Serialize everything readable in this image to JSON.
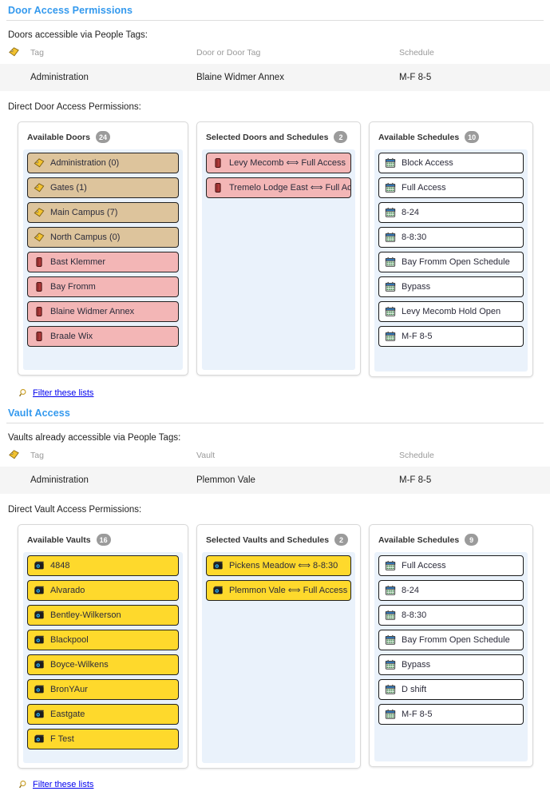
{
  "door_section": {
    "title": "Door Access Permissions",
    "tag_caption": "Doors accessible via People Tags:",
    "table": {
      "headers": [
        "Tag",
        "Door or Door Tag",
        "Schedule"
      ],
      "rows": [
        [
          "Administration",
          "Blaine Widmer Annex",
          "M-F 8-5"
        ]
      ]
    },
    "direct_caption": "Direct Door Access Permissions:",
    "available": {
      "label": "Available Doors",
      "count": "24",
      "items": [
        {
          "text": "Administration (0)",
          "kind": "tag"
        },
        {
          "text": "Gates (1)",
          "kind": "tag"
        },
        {
          "text": "Main Campus (7)",
          "kind": "tag"
        },
        {
          "text": "North Campus (0)",
          "kind": "tag"
        },
        {
          "text": "Bast Klemmer",
          "kind": "door"
        },
        {
          "text": "Bay Fromm",
          "kind": "door"
        },
        {
          "text": "Blaine Widmer Annex",
          "kind": "door"
        },
        {
          "text": "Braale Wix",
          "kind": "door"
        }
      ]
    },
    "selected": {
      "label": "Selected Doors and Schedules",
      "count": "2",
      "items": [
        {
          "text": "Levy Mecomb ⟺ Full Access",
          "kind": "door"
        },
        {
          "text": "Tremelo Lodge East ⟺ Full Access",
          "kind": "door"
        }
      ]
    },
    "schedules": {
      "label": "Available Schedules",
      "count": "10",
      "items": [
        {
          "text": "Block Access",
          "kind": "schedule"
        },
        {
          "text": "Full Access",
          "kind": "schedule"
        },
        {
          "text": "8-24",
          "kind": "schedule"
        },
        {
          "text": "8-8:30",
          "kind": "schedule"
        },
        {
          "text": "Bay Fromm Open Schedule",
          "kind": "schedule"
        },
        {
          "text": "Bypass",
          "kind": "schedule"
        },
        {
          "text": "Levy Mecomb Hold Open",
          "kind": "schedule"
        },
        {
          "text": "M-F 8-5",
          "kind": "schedule"
        }
      ]
    },
    "filter_label": "Filter these lists"
  },
  "vault_section": {
    "title": "Vault Access",
    "tag_caption": "Vaults already accessible via People Tags:",
    "table": {
      "headers": [
        "Tag",
        "Vault",
        "Schedule"
      ],
      "rows": [
        [
          "Administration",
          "Plemmon Vale",
          "M-F 8-5"
        ]
      ]
    },
    "direct_caption": "Direct Vault Access Permissions:",
    "available": {
      "label": "Available Vaults",
      "count": "16",
      "items": [
        {
          "text": "4848",
          "kind": "vault"
        },
        {
          "text": "Alvarado",
          "kind": "vault"
        },
        {
          "text": "Bentley-Wilkerson",
          "kind": "vault"
        },
        {
          "text": "Blackpool",
          "kind": "vault"
        },
        {
          "text": "Boyce-Wilkens",
          "kind": "vault"
        },
        {
          "text": "BronYAur",
          "kind": "vault"
        },
        {
          "text": "Eastgate",
          "kind": "vault"
        },
        {
          "text": "F Test",
          "kind": "vault"
        }
      ]
    },
    "selected": {
      "label": "Selected Vaults and Schedules",
      "count": "2",
      "items": [
        {
          "text": "Pickens Meadow ⟺ 8-8:30",
          "kind": "vault"
        },
        {
          "text": "Plemmon Vale ⟺ Full Access",
          "kind": "vault"
        }
      ]
    },
    "schedules": {
      "label": "Available Schedules",
      "count": "9",
      "items": [
        {
          "text": "Full Access",
          "kind": "schedule"
        },
        {
          "text": "8-24",
          "kind": "schedule"
        },
        {
          "text": "8-8:30",
          "kind": "schedule"
        },
        {
          "text": "Bay Fromm Open Schedule",
          "kind": "schedule"
        },
        {
          "text": "Bypass",
          "kind": "schedule"
        },
        {
          "text": "D shift",
          "kind": "schedule"
        },
        {
          "text": "M-F 8-5",
          "kind": "schedule"
        }
      ]
    },
    "filter_label": "Filter these lists"
  },
  "colors": {
    "section_title": "#3399ee",
    "tag_item": "#ddc49c",
    "door_item": "#f3b6b6",
    "vault_item": "#fed92c",
    "schedule_item": "#ffffff",
    "list_bg": "#eaf2fb",
    "badge": "#9b9b9b",
    "link": "#0000ee"
  }
}
